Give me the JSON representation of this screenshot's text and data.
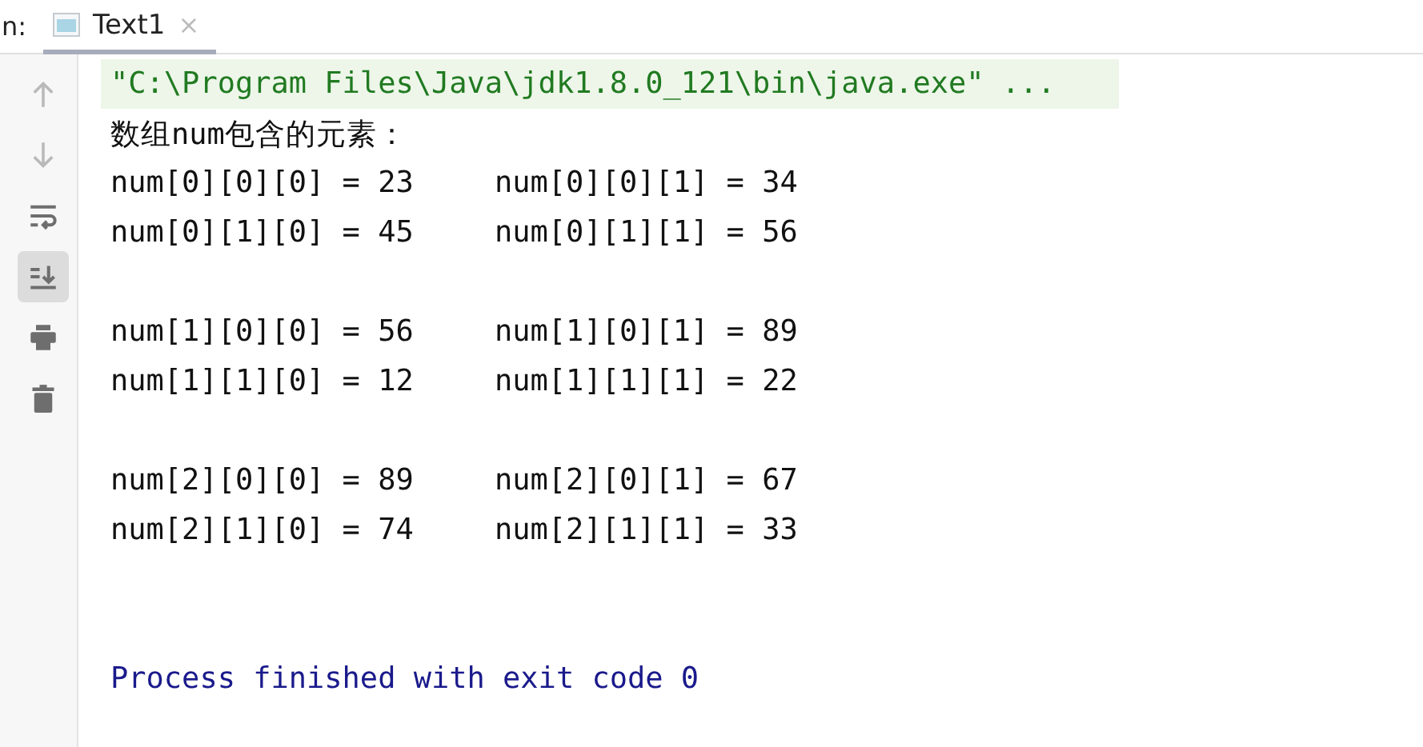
{
  "header": {
    "label": "n:",
    "tabs": [
      {
        "label": "Text1",
        "selected": true,
        "close": "×"
      }
    ]
  },
  "toolbar": [
    {
      "kind": "up",
      "disabled": true,
      "selected": false
    },
    {
      "kind": "down",
      "disabled": true,
      "selected": false
    },
    {
      "kind": "wrap",
      "disabled": false,
      "selected": false
    },
    {
      "kind": "scroll-end",
      "disabled": false,
      "selected": true
    },
    {
      "kind": "print",
      "disabled": false,
      "selected": false
    },
    {
      "kind": "trash",
      "disabled": false,
      "selected": false
    }
  ],
  "console": [
    {
      "kind": "command",
      "cells": [
        "\"C:\\Program Files\\Java\\jdk1.8.0_121\\bin\\java.exe\" ..."
      ]
    },
    {
      "kind": "text",
      "cells": [
        "数组num包含的元素："
      ]
    },
    {
      "kind": "text",
      "cells": [
        "num[0][0][0] = 23",
        "num[0][0][1] = 34"
      ]
    },
    {
      "kind": "text",
      "cells": [
        "num[0][1][0] = 45",
        "num[0][1][1] = 56"
      ]
    },
    {
      "kind": "blank"
    },
    {
      "kind": "text",
      "cells": [
        "num[1][0][0] = 56",
        "num[1][0][1] = 89"
      ]
    },
    {
      "kind": "text",
      "cells": [
        "num[1][1][0] = 12",
        "num[1][1][1] = 22"
      ]
    },
    {
      "kind": "blank"
    },
    {
      "kind": "text",
      "cells": [
        "num[2][0][0] = 89",
        "num[2][0][1] = 67"
      ]
    },
    {
      "kind": "text",
      "cells": [
        "num[2][1][0] = 74",
        "num[2][1][1] = 33"
      ]
    },
    {
      "kind": "blank"
    },
    {
      "kind": "blank"
    },
    {
      "kind": "exit",
      "cells": [
        "Process finished with exit code 0"
      ]
    }
  ]
}
